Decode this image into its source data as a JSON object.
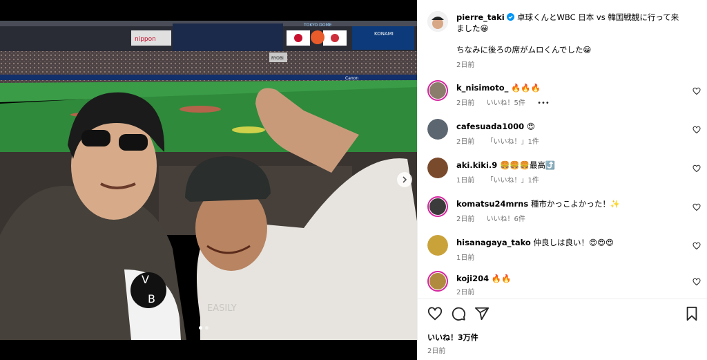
{
  "post": {
    "author": "pierre_taki",
    "caption_line1": "卓球くんとWBC 日本 vs 韓国戦観に行って来ました😀",
    "caption_line2": "ちなみに後ろの席がムロくんでした😀",
    "time": "2日前",
    "verified": true
  },
  "photo": {
    "stadium_sign": "TOKYO DOME",
    "shirt_text": "EASILY",
    "sponsor_left": "nippon",
    "sponsor_right": "KONAMI",
    "ad_canon": "Canon",
    "ad_ryobi": "RYOBI"
  },
  "comments": [
    {
      "user": "k_nisimoto_",
      "text": "🔥🔥🔥",
      "time": "2日前",
      "likes": "いいね！5件",
      "more": "•••",
      "ring": true,
      "avatar_color": "#8a7d6b"
    },
    {
      "user": "cafesuada1000",
      "text": "😍",
      "time": "2日前",
      "likes": "「いいね！」1件",
      "ring": false,
      "avatar_color": "#5c6670"
    },
    {
      "user": "aki.kiki.9",
      "text": "🍔🍔🍔最高⤴️",
      "time": "1日前",
      "likes": "「いいね！」1件",
      "ring": false,
      "avatar_color": "#7a4a2c"
    },
    {
      "user": "komatsu24mrns",
      "text": "種市かっこよかった！✨",
      "time": "2日前",
      "likes": "いいね！6件",
      "ring": true,
      "avatar_color": "#3b3b3b"
    },
    {
      "user": "hisanagaya_tako",
      "text": "仲良しは良い！😍😍😍",
      "time": "1日前",
      "likes": "",
      "ring": false,
      "avatar_color": "#c9a23a"
    },
    {
      "user": "koji204",
      "text": "🔥🔥",
      "time": "2日前",
      "likes": "",
      "ring": true,
      "avatar_color": "#b08a3e"
    }
  ],
  "actions": {
    "like_count": "いいね！3万件",
    "posted_time": "2日前"
  },
  "icons": [
    "heart-icon",
    "comment-icon",
    "share-icon",
    "bookmark-icon",
    "verified-icon",
    "next-arrow-icon"
  ]
}
